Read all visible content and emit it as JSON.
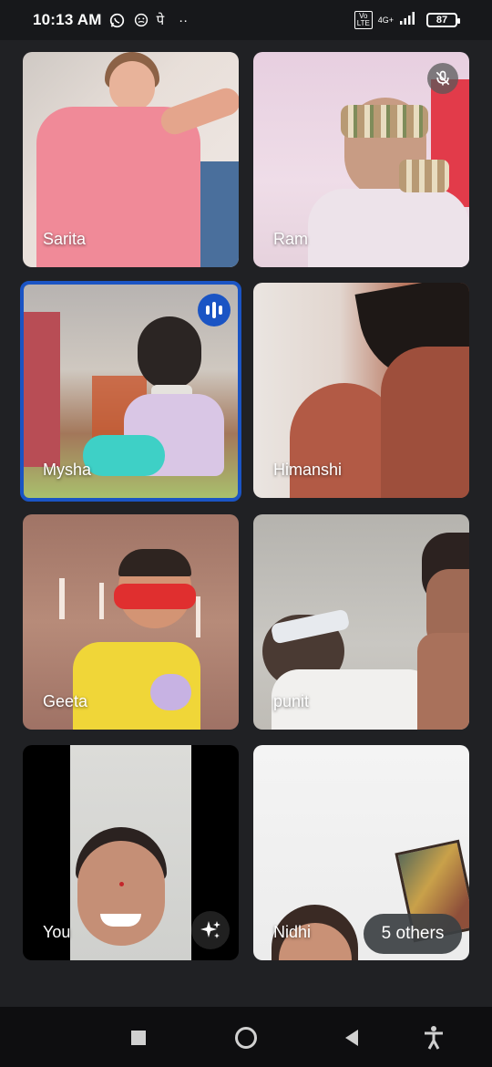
{
  "status_bar": {
    "time": "10:13 AM",
    "extra_glyph": "पे",
    "more_dots": "··",
    "volte_label": "Vo LTE",
    "network_label": "4G+",
    "battery_level": "87",
    "icons": [
      "whatsapp-icon",
      "emoji-icon",
      "volte-icon",
      "signal-icon",
      "battery-icon"
    ]
  },
  "participants": [
    {
      "name": "Sarita",
      "muted": false,
      "speaking": false
    },
    {
      "name": "Ram",
      "muted": true,
      "speaking": false
    },
    {
      "name": "Mysha",
      "muted": false,
      "speaking": true
    },
    {
      "name": "Himanshi",
      "muted": false,
      "speaking": false
    },
    {
      "name": "Geeta",
      "muted": false,
      "speaking": false
    },
    {
      "name": "punit",
      "muted": false,
      "speaking": false
    },
    {
      "name": "You",
      "muted": false,
      "speaking": false
    },
    {
      "name": "Nidhi",
      "muted": false,
      "speaking": false
    }
  ],
  "others_label": "5 others",
  "colors": {
    "background": "#202124",
    "active_speaker": "#1a54c4",
    "nav_bar": "#0e0e10"
  },
  "nav": {
    "icons": [
      "recents-square-icon",
      "home-circle-icon",
      "back-triangle-icon",
      "accessibility-icon"
    ]
  }
}
